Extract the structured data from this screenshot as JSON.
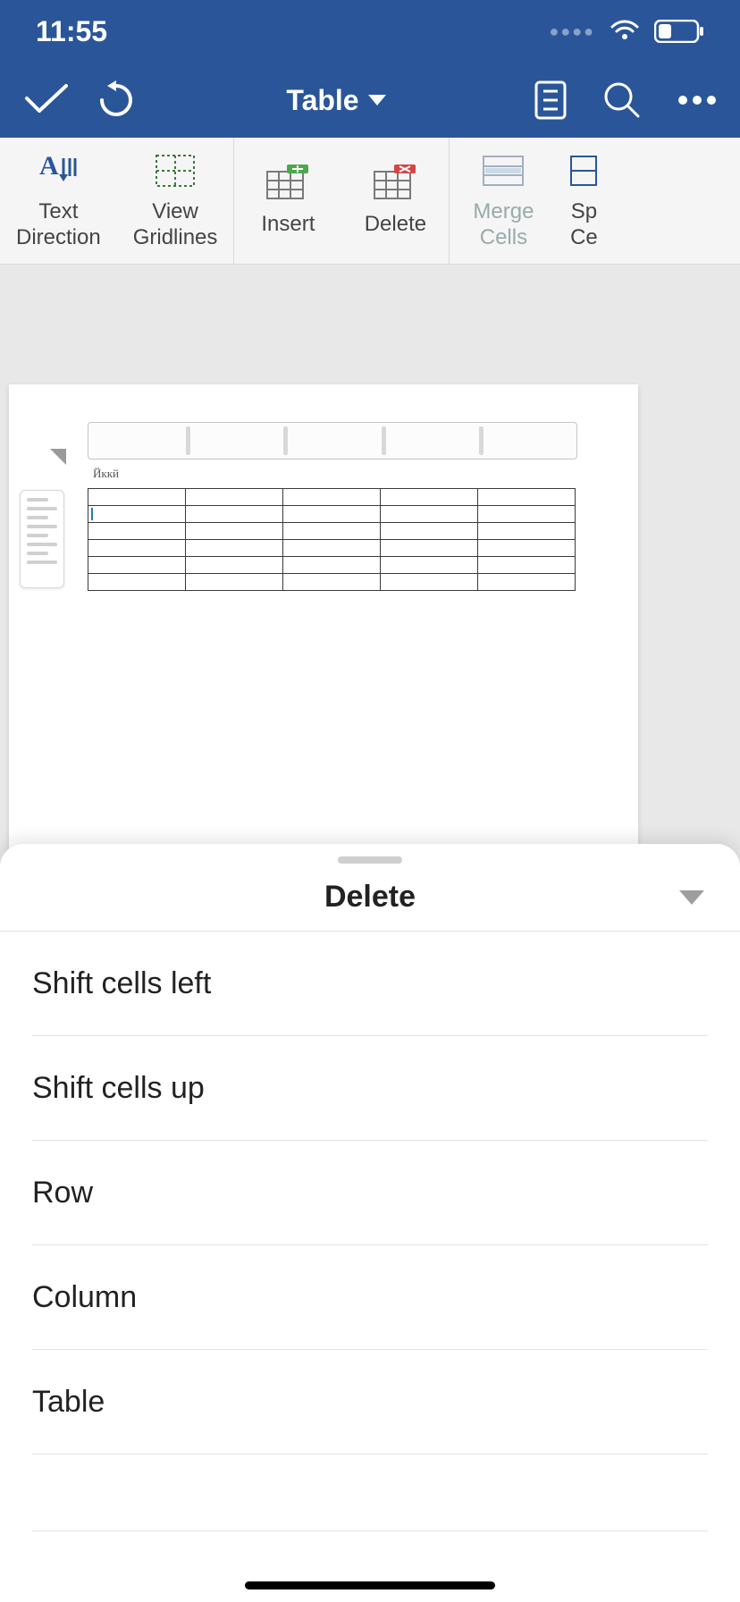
{
  "status": {
    "time": "11:55"
  },
  "header": {
    "tab_label": "Table"
  },
  "ribbon": {
    "text_direction": "Text\nDirection",
    "view_gridlines": "View\nGridlines",
    "insert": "Insert",
    "delete": "Delete",
    "merge_cells": "Merge\nCells",
    "split_cells": "Sp\nCe"
  },
  "document": {
    "inline_text": "Йккй"
  },
  "sheet": {
    "title": "Delete",
    "options": [
      "Shift cells left",
      "Shift cells up",
      "Row",
      "Column",
      "Table"
    ]
  }
}
